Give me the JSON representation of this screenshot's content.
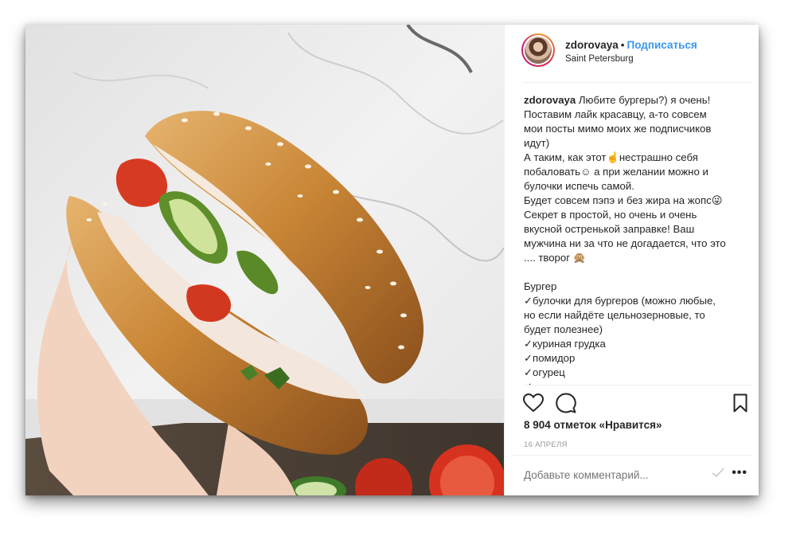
{
  "post": {
    "username": "zdorovaya",
    "separator": "•",
    "follow_label": "Подписаться",
    "location": "Saint Petersburg",
    "caption_lines": [
      "Любите бургеры?) я очень!",
      "Поставим лайк красавцу, а-то совсем",
      "мои посты мимо моих же подписчиков",
      "идут)",
      "А таким, как этот☝️нестрашно себя",
      "побаловать☺ а при желании можно и",
      "булочки испечь самой.",
      "Будет совсем пэпэ и без жира на жопс😜",
      "Секрет в простой, но очень и очень",
      "вкусной остренькой заправке! Ваш",
      "мужчина ни за что не догадается, что это",
      ".... творог 🙊",
      "",
      "Бургер",
      "✓булочки для бургеров (можно любые,",
      "но если найдёте цельнозерновые, то",
      "будет полезнее)",
      "✓куриная грудка",
      "✓помидор",
      "✓огурец",
      "✓"
    ],
    "likes_text": "8 904 отметок «Нравится»",
    "date_text": "16 АПРЕЛЯ",
    "comment_placeholder": "Добавьте комментарий...",
    "more_label": "•••"
  },
  "icons": {
    "like": "heart-icon",
    "comment": "comment-icon",
    "save": "bookmark-icon",
    "more": "more-options-icon"
  },
  "colors": {
    "accent": "#3897f0",
    "text": "#262626",
    "muted": "#999999",
    "border": "#efefef"
  }
}
